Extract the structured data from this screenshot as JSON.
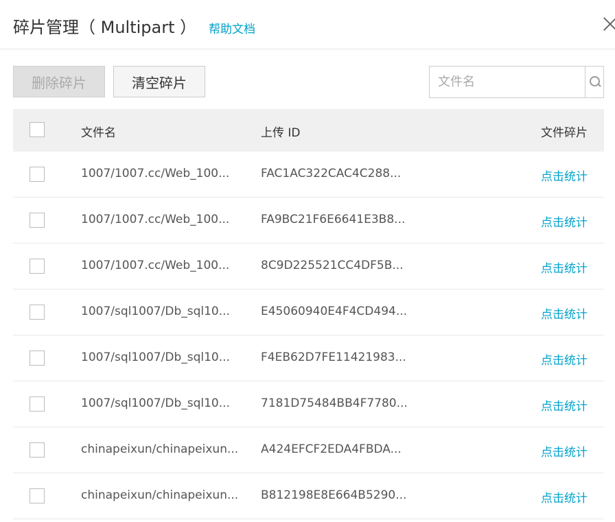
{
  "dialog": {
    "title": "碎片管理（ Multipart ）",
    "help_link": "帮助文档",
    "close_icon": "close-icon"
  },
  "toolbar": {
    "delete_label": "删除碎片",
    "clear_label": "清空碎片",
    "search_placeholder": "文件名",
    "search_value": ""
  },
  "table": {
    "columns": [
      "文件名",
      "上传 ID",
      "文件碎片"
    ],
    "rows": [
      {
        "name": "1007/1007.cc/Web_100...",
        "upload_id": "FAC1AC322CAC4C288...",
        "action": "点击统计"
      },
      {
        "name": "1007/1007.cc/Web_100...",
        "upload_id": "FA9BC21F6E6641E3B8...",
        "action": "点击统计"
      },
      {
        "name": "1007/1007.cc/Web_100...",
        "upload_id": "8C9D225521CC4DF5B...",
        "action": "点击统计"
      },
      {
        "name": "1007/sql1007/Db_sql10...",
        "upload_id": "E45060940E4F4CD494...",
        "action": "点击统计"
      },
      {
        "name": "1007/sql1007/Db_sql10...",
        "upload_id": "F4EB62D7FE11421983...",
        "action": "点击统计"
      },
      {
        "name": "1007/sql1007/Db_sql10...",
        "upload_id": "7181D75484BB4F7780...",
        "action": "点击统计"
      },
      {
        "name": "chinapeixun/chinapeixun...",
        "upload_id": "A424EFCF2EDA4FBDA...",
        "action": "点击统计"
      },
      {
        "name": "chinapeixun/chinapeixun...",
        "upload_id": "B812198E8E664B5290...",
        "action": "点击统计"
      }
    ]
  },
  "colors": {
    "link": "#00a2ca",
    "header_bg": "#f0f0f0",
    "disabled_button_bg": "#e0e0e0"
  }
}
